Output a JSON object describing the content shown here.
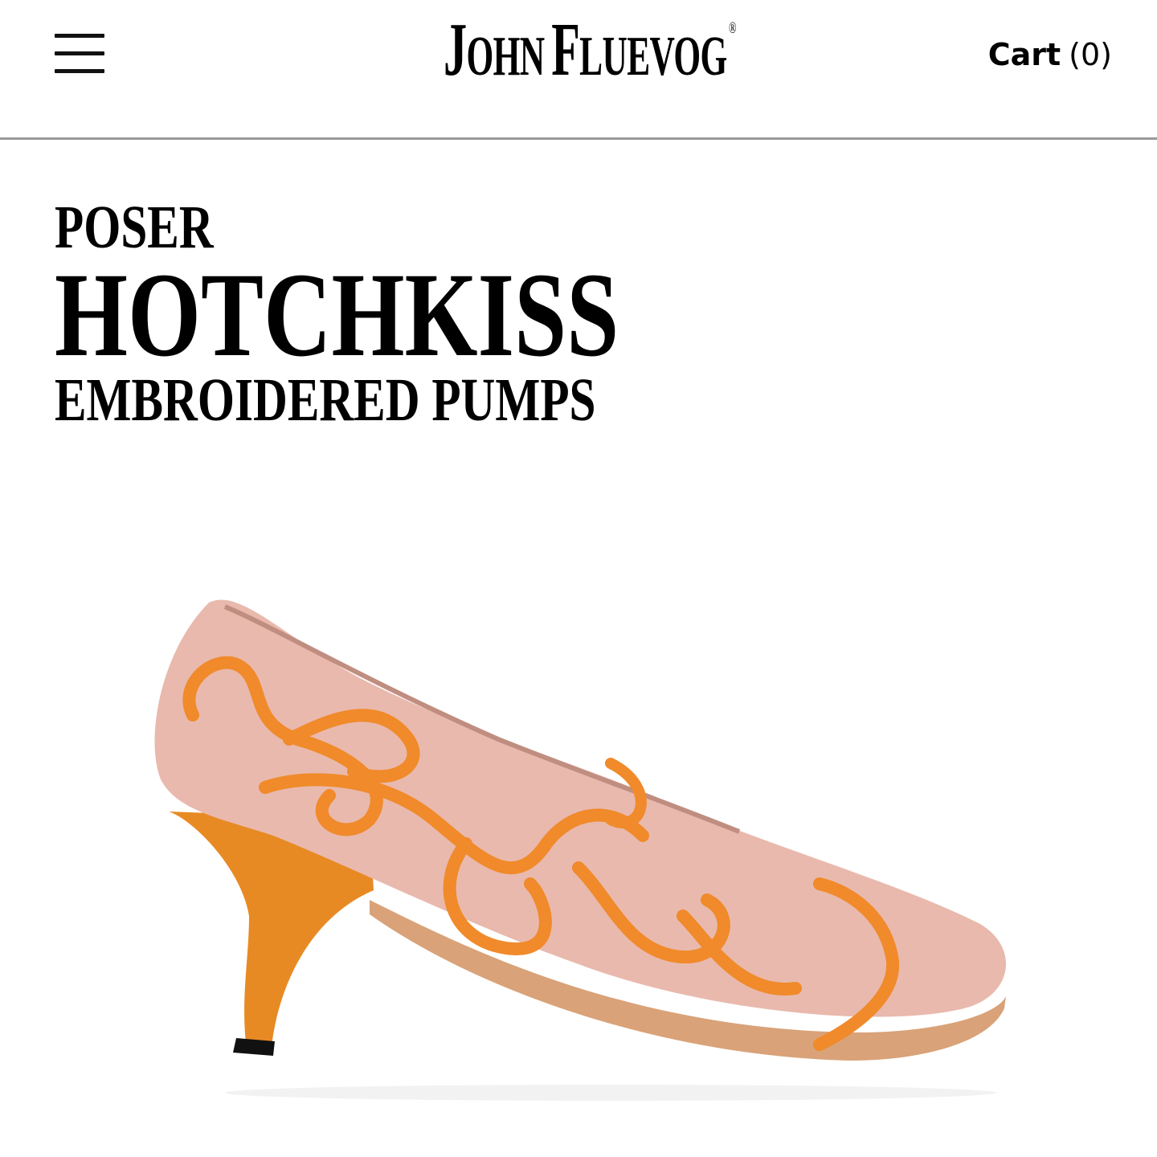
{
  "header": {
    "menu_icon": "hamburger-menu-icon",
    "logo": {
      "first_initial": "J",
      "first_rest": "OHN",
      "last_initial": "F",
      "last_rest": "LUEVOG",
      "mark": "®"
    },
    "cart": {
      "label": "Cart",
      "count": "(0)"
    }
  },
  "product": {
    "collection": "POSER",
    "name": "HOTCHKISS",
    "subtitle": "EMBROIDERED PUMPS",
    "image": "pink-patent-pump-with-orange-embroidery-and-orange-flared-heel"
  },
  "colors": {
    "text": "#000000",
    "divider": "#9a9a9a",
    "shoe_upper": "#e9b9ad",
    "embroidery": "#f08a2a",
    "heel": "#e88a24"
  }
}
